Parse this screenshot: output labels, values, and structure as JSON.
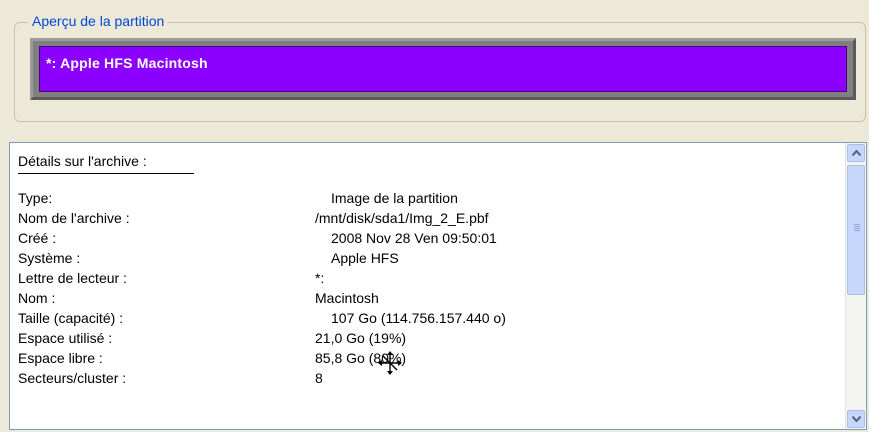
{
  "partition_preview": {
    "legend": "Aperçu de la partition",
    "selected_partition": "*: Apple HFS Macintosh",
    "colors": {
      "partition_bar": "#8b00ff",
      "legend_text": "#0046d5"
    }
  },
  "details": {
    "heading": "Détails sur l'archive :",
    "rows": [
      {
        "key": "Type:",
        "value": "Image de la partition"
      },
      {
        "key": "Nom de l'archive :",
        "value": "/mnt/disk/sda1/Img_2_E.pbf"
      },
      {
        "key": "Créé :",
        "value": "2008 Nov 28 Ven 09:50:01"
      },
      {
        "key": "Système :",
        "value": "Apple HFS"
      },
      {
        "key": "Lettre de lecteur :",
        "value": "*:"
      },
      {
        "key": "Nom :",
        "value": "Macintosh"
      },
      {
        "key": "Taille (capacité) :",
        "value": "107 Go (114.756.157.440 o)"
      },
      {
        "key": "Espace utilisé :",
        "value": "21,0 Go (19%)"
      },
      {
        "key": "Espace libre :",
        "value": "85,8 Go (80%)"
      },
      {
        "key": "Secteurs/cluster :",
        "value": "8"
      }
    ]
  },
  "scrollbar": {
    "up_icon": "arrow-up-icon",
    "down_icon": "arrow-down-icon"
  },
  "cursor_icon": "move-cursor-icon"
}
